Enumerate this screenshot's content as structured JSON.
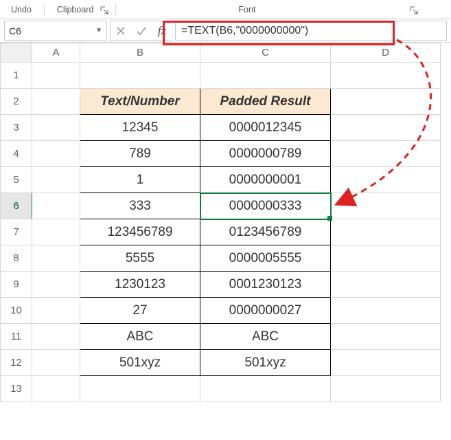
{
  "ribbon": {
    "undo": "Undo",
    "clipboard": "Clipboard",
    "font": "Font"
  },
  "namebox": {
    "value": "C6"
  },
  "fx_label": "fx",
  "formula": "=TEXT(B6,\"0000000000\")",
  "columns": {
    "A": "A",
    "B": "B",
    "C": "C",
    "D": "D"
  },
  "rows": {
    "r1": "1",
    "r2": "2",
    "r3": "3",
    "r4": "4",
    "r5": "5",
    "r6": "6",
    "r7": "7",
    "r8": "8",
    "r9": "9",
    "r10": "10",
    "r11": "11",
    "r12": "12",
    "r13": "13"
  },
  "headers": {
    "b": "Text/Number",
    "c": "Padded Result"
  },
  "data": {
    "b3": "12345",
    "c3": "0000012345",
    "b4": "789",
    "c4": "0000000789",
    "b5": "1",
    "c5": "0000000001",
    "b6": "333",
    "c6": "0000000333",
    "b7": "123456789",
    "c7": "0123456789",
    "b8": "5555",
    "c8": "0000005555",
    "b9": "1230123",
    "c9": "0001230123",
    "b10": "27",
    "c10": "0000000027",
    "b11": "ABC",
    "c11": "ABC",
    "b12": "501xyz",
    "c12": "501xyz"
  }
}
